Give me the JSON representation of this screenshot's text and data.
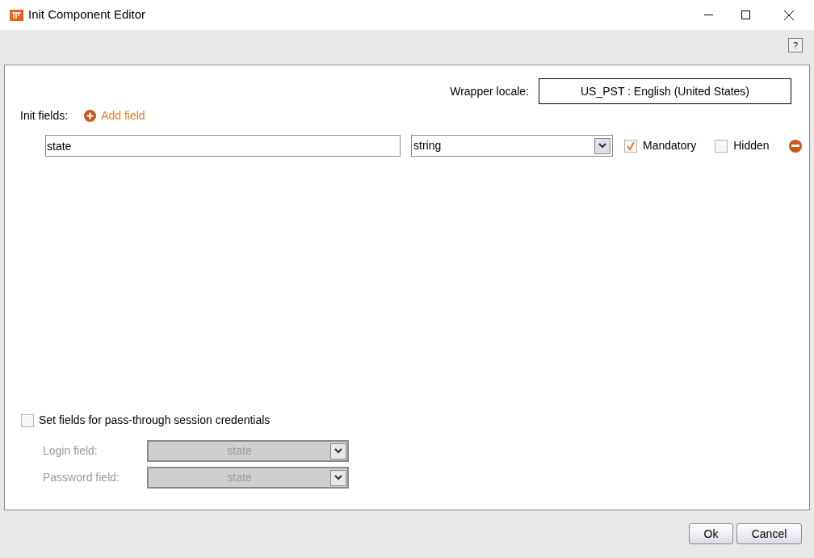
{
  "window": {
    "title": "Init Component Editor"
  },
  "help_button": "?",
  "wrapper_locale": {
    "label": "Wrapper locale:",
    "value": "US_PST :  English (United States)"
  },
  "init_fields": {
    "label": "Init fields:",
    "add_link": "Add field",
    "rows": [
      {
        "name": "state",
        "type": "string",
        "mandatory": {
          "label": "Mandatory",
          "checked": true
        },
        "hidden": {
          "label": "Hidden",
          "checked": false
        }
      }
    ]
  },
  "credentials": {
    "label": "Set fields for pass-through session credentials",
    "checked": false,
    "fields": [
      {
        "label": "Login field:",
        "value": "state",
        "disabled": true
      },
      {
        "label": "Password field:",
        "value": "state",
        "disabled": true
      }
    ]
  },
  "buttons": [
    "Ok",
    "Cancel"
  ]
}
